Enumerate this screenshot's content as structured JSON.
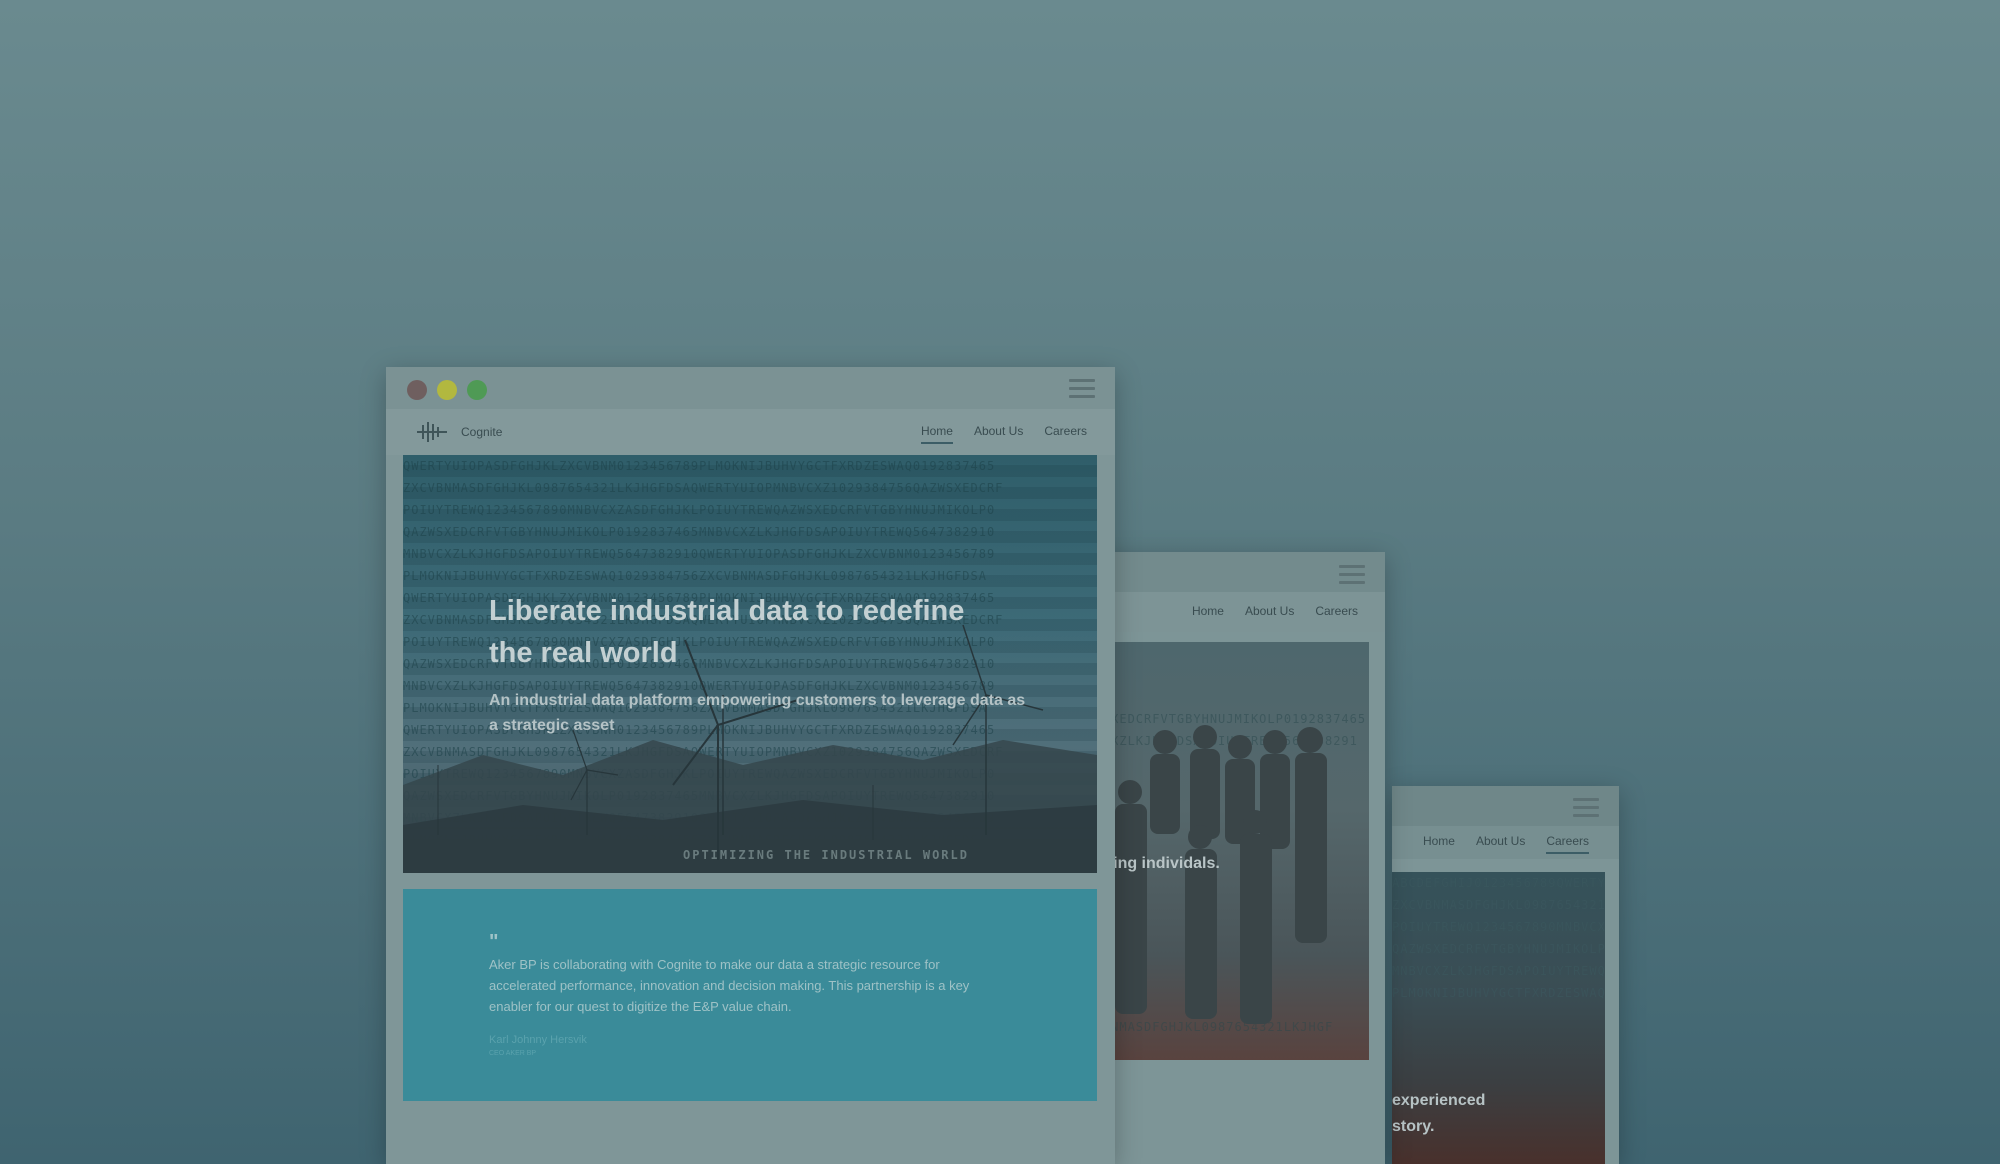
{
  "nav": {
    "brand": "Cognite",
    "links": [
      "Home",
      "About Us",
      "Careers"
    ]
  },
  "front_window": {
    "hero_title": "Liberate industrial data to redefine the real world",
    "hero_subtitle": "An industrial data platform empowering customers to leverage data as a strategic asset",
    "hero_tagline": "OPTIMIZING THE INDUSTRIAL WORLD",
    "quote_text": "Aker BP is collaborating with Cognite to make our data a strategic resource for accelerated performance, innovation and decision making. This partnership is a key enabler for our quest to digitize the E&P value chain.",
    "quote_author": "Karl Johnny Hersvik",
    "quote_role": "CEO AKER BP"
  },
  "middle_window": {
    "hero_text": "powering individals."
  },
  "back_window": {
    "hero_text_line1": "experienced",
    "hero_text_line2": "story."
  },
  "colors": {
    "traffic_red": "#6f5f5f",
    "traffic_yellow": "#b2b83f",
    "traffic_green": "#4f9a55"
  }
}
